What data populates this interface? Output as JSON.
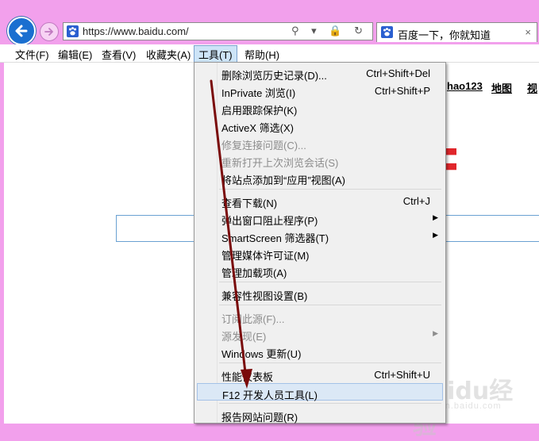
{
  "browser": {
    "address_url": "https://www.baidu.com/",
    "tab_title": "百度一下，你就知道",
    "tab_close": "×",
    "addr_tools": "⚲ ▾ 🔒 ↻"
  },
  "menubar": {
    "items": [
      "文件(F)",
      "编辑(E)",
      "查看(V)",
      "收藏夹(A)",
      "工具(T)",
      "帮助(H)"
    ],
    "active": "工具(T)"
  },
  "page": {
    "links": [
      "hao123",
      "地图",
      "视"
    ]
  },
  "tools_menu": {
    "items": [
      {
        "label": "删除浏览历史记录(D)...",
        "shortcut": "Ctrl+Shift+Del"
      },
      {
        "label": "InPrivate 浏览(I)",
        "shortcut": "Ctrl+Shift+P"
      },
      {
        "label": "启用跟踪保护(K)",
        "shortcut": ""
      },
      {
        "label": "ActiveX 筛选(X)",
        "shortcut": ""
      },
      {
        "label": "修复连接问题(C)...",
        "shortcut": "",
        "disabled": true
      },
      {
        "label": "重新打开上次浏览会话(S)",
        "shortcut": "",
        "disabled": true
      },
      {
        "label": "将站点添加到“应用”视图(A)",
        "shortcut": ""
      },
      {
        "label": "查看下载(N)",
        "shortcut": "Ctrl+J"
      },
      {
        "label": "弹出窗口阻止程序(P)",
        "shortcut": "",
        "submenu": true
      },
      {
        "label": "SmartScreen 筛选器(T)",
        "shortcut": "",
        "submenu": true
      },
      {
        "label": "管理媒体许可证(M)",
        "shortcut": ""
      },
      {
        "label": "管理加载项(A)",
        "shortcut": ""
      },
      {
        "label": "兼容性视图设置(B)",
        "shortcut": ""
      },
      {
        "label": "订阅此源(F)...",
        "shortcut": "",
        "disabled": true
      },
      {
        "label": "源发现(E)",
        "shortcut": "",
        "disabled": true,
        "submenu": true
      },
      {
        "label": "Windows 更新(U)",
        "shortcut": ""
      },
      {
        "label": "性能仪表板",
        "shortcut": "Ctrl+Shift+U"
      },
      {
        "label": "F12 开发人员工具(L)",
        "shortcut": "",
        "highlighted": true
      },
      {
        "label": "报告网站问题(R)",
        "shortcut": ""
      }
    ]
  },
  "watermark": {
    "text": "Baidu经验",
    "sub": "jingyan.baidu.com"
  },
  "colors": {
    "window_frame": "#f2a0ec",
    "arrow": "#7a0b0b",
    "highlight": "#dbe8f6"
  }
}
